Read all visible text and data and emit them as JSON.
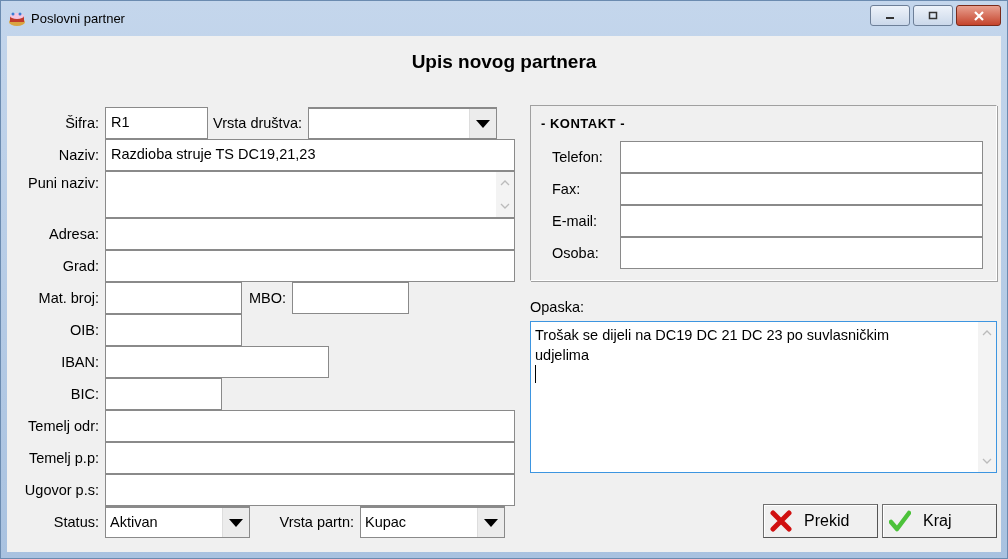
{
  "window": {
    "title": "Poslovni partner"
  },
  "heading": "Upis novog partnera",
  "form": {
    "rows": [
      {
        "fields": [
          {
            "label": "Šifra:",
            "kind": "text",
            "value": "R1"
          },
          {
            "label": "Vrsta društva:",
            "kind": "combo"
          }
        ]
      },
      {
        "fields": [
          {
            "label": "Naziv:",
            "kind": "text",
            "value": "Razdioba struje TS DC19,21,23"
          }
        ]
      },
      {
        "fields": [
          {
            "label": "Puni naziv:",
            "kind": "memo"
          }
        ]
      },
      {
        "fields": [
          {
            "label": "Adresa:",
            "kind": "text"
          }
        ]
      },
      {
        "fields": [
          {
            "label": "Grad:",
            "kind": "text"
          }
        ]
      },
      {
        "fields": [
          {
            "label": "Mat. broj:",
            "kind": "text"
          },
          {
            "label": "MBO:",
            "kind": "text"
          }
        ]
      },
      {
        "fields": [
          {
            "label": "OIB:",
            "kind": "text"
          }
        ]
      },
      {
        "fields": [
          {
            "label": "IBAN:",
            "kind": "text"
          }
        ]
      },
      {
        "fields": [
          {
            "label": "BIC:",
            "kind": "text"
          }
        ]
      },
      {
        "fields": [
          {
            "label": "Temelj odr:",
            "kind": "text"
          }
        ]
      },
      {
        "fields": [
          {
            "label": "Temelj p.p:",
            "kind": "text"
          }
        ]
      },
      {
        "fields": [
          {
            "label": "Ugovor p.s:",
            "kind": "text"
          }
        ]
      },
      {
        "fields": [
          {
            "label": "Status:",
            "kind": "combo",
            "value": "Aktivan"
          },
          {
            "label": "Vrsta partn:",
            "kind": "combo",
            "value": "Kupac"
          }
        ]
      }
    ]
  },
  "contact": {
    "title": "- KONTAKT -",
    "fields": [
      {
        "label": "Telefon:"
      },
      {
        "label": "Fax:"
      },
      {
        "label": "E-mail:"
      },
      {
        "label": "Osoba:"
      }
    ]
  },
  "remark": {
    "label": "Opaska:",
    "value": "Trošak se dijeli na DC19 DC 21 DC 23 po suvlasničkim udjelima",
    "focused": true
  },
  "buttons": [
    {
      "label": "Prekid",
      "kind": "cancel"
    },
    {
      "label": "Kraj",
      "kind": "ok"
    }
  ]
}
